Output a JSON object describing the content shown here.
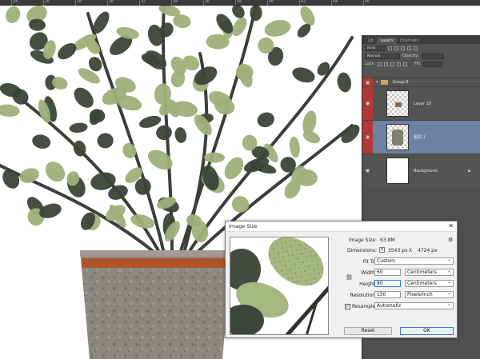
{
  "ruler": {
    "numbers": [
      "24",
      "26",
      "28",
      "30",
      "32",
      "34",
      "36",
      "38",
      "40",
      "42",
      "44",
      "46"
    ]
  },
  "layers_panel": {
    "tabs": [
      "Lib",
      "Layers",
      "Channels"
    ],
    "active_tab": "Layers",
    "kind_label": "Kind",
    "blend_mode": "Normal",
    "opacity_label": "Opacity:",
    "lock_label": "Lock:",
    "fill_label": "Fill:",
    "layers": [
      {
        "name": "Group 8",
        "type": "group",
        "visible": true,
        "highlighted": true
      },
      {
        "name": "Layer 10",
        "type": "layer",
        "visible": true,
        "highlighted": true
      },
      {
        "name": "图层 1",
        "type": "layer",
        "visible": true,
        "highlighted": true,
        "selected": true
      },
      {
        "name": "Background",
        "type": "background",
        "visible": true,
        "highlighted": false
      }
    ]
  },
  "dialog": {
    "title": "Image Size",
    "image_size_label": "Image Size:",
    "image_size_value": "63.8M",
    "dimensions_label": "Dimensions:",
    "dimensions_w": "3543 px",
    "dimensions_x": "X",
    "dimensions_h": "4724 px",
    "fit_to_label": "Fit To:",
    "fit_to_value": "Custom",
    "width_label": "Width:",
    "width_value": "60",
    "width_unit": "Centimeters",
    "height_label": "Height:",
    "height_value": "80",
    "height_unit": "Centimeters",
    "resolution_label": "Resolution:",
    "resolution_value": "150",
    "resolution_unit": "Pixels/Inch",
    "resample_label": "Resample:",
    "resample_checked": true,
    "resample_value": "Automatic",
    "reset_label": "Reset",
    "ok_label": "OK"
  },
  "colors": {
    "accent_red": "#b13838",
    "selected_blue": "#6d82a3",
    "panel_bg": "#535353",
    "leaf_dark": "#3b4437",
    "leaf_light": "#9fb07a"
  }
}
